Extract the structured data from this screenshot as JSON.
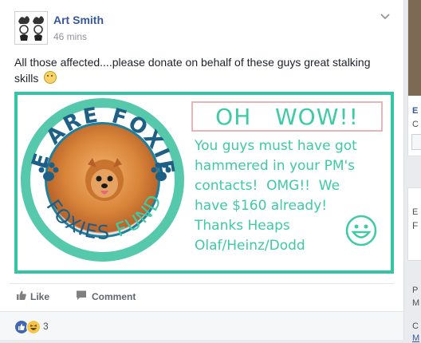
{
  "post": {
    "author": "Art Smith",
    "timestamp": "46 mins",
    "text": "All those affected....please donate on behalf of these guys great stalking skills",
    "text_emoji": "smile-emoji"
  },
  "image": {
    "circle_text": "WE ARE FOXIES FUND",
    "circle_main": "WE ARE FOXIES",
    "circle_accent": "FUND",
    "headline": "OH   WOW!!",
    "message_lines": [
      "You guys must have got",
      "hammered in your PM's",
      "contacts!  OMG!!  We",
      "have $160 already!",
      "Thanks Heaps",
      "Olaf/Heinz/Dodd"
    ],
    "colors": {
      "frame": "#36c5a4",
      "text": "#3dcaa4",
      "circle": "#56c9ad",
      "accent": "#1e7f9e"
    }
  },
  "actions": {
    "like": "Like",
    "comment": "Comment"
  },
  "reactions": {
    "icons": [
      "like-icon",
      "haha-icon"
    ],
    "count": "3"
  },
  "sidebar": {
    "letters": [
      "E",
      "C",
      "E",
      "F",
      "P",
      "M",
      "C"
    ],
    "link": "M"
  }
}
